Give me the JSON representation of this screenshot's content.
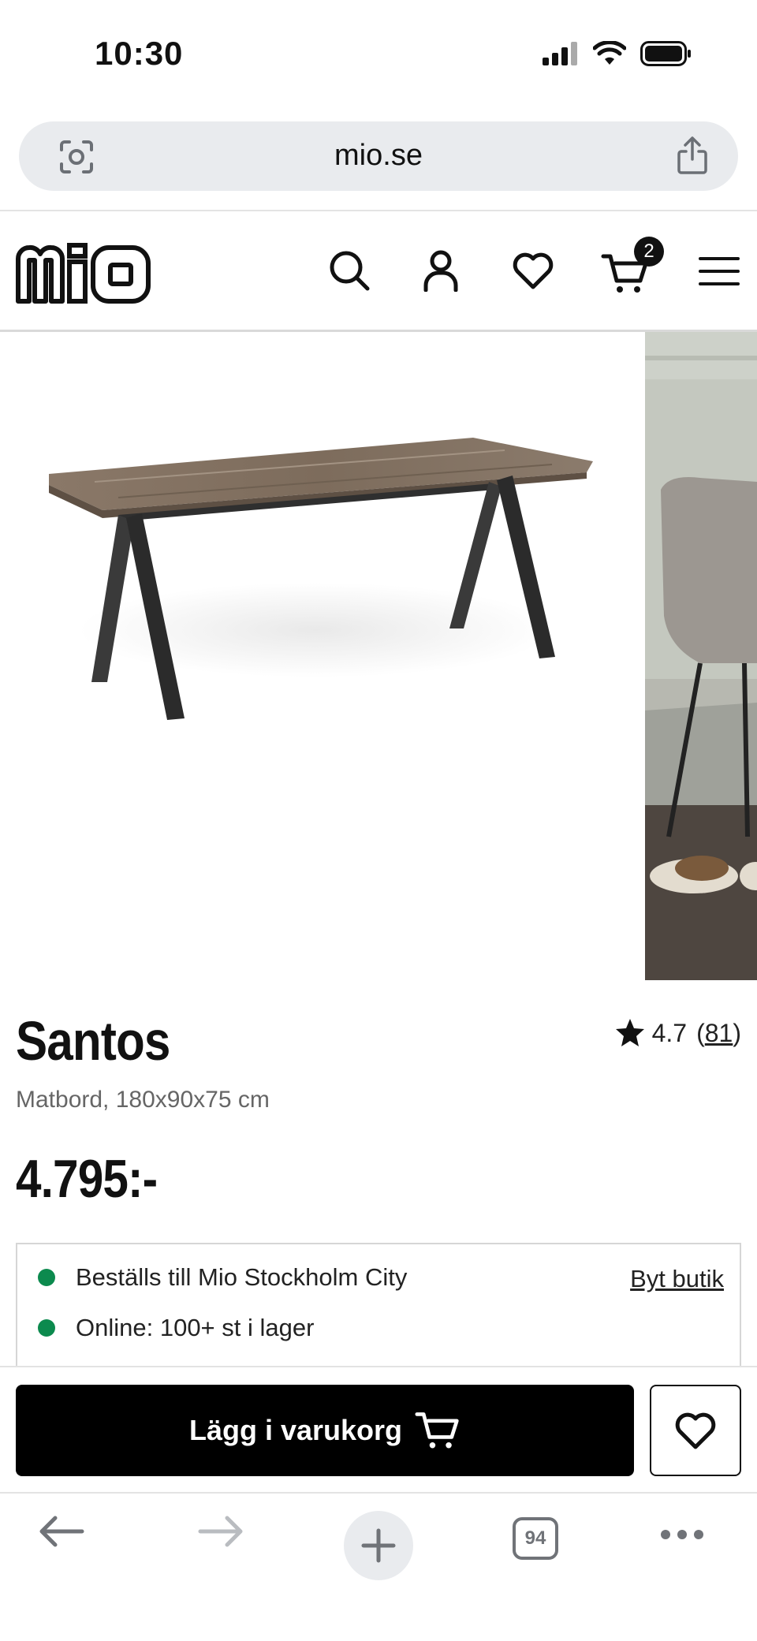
{
  "status_bar": {
    "time": "10:30"
  },
  "address_bar": {
    "url": "mio.se"
  },
  "site_header": {
    "logo_text": "mio",
    "cart_count": "2"
  },
  "product": {
    "title": "Santos",
    "subtitle": "Matbord, 180x90x75 cm",
    "price": "4.795:-",
    "rating_value": "4.7",
    "rating_count_open": "(",
    "rating_count": "81",
    "rating_count_close": ")"
  },
  "stock": {
    "store_line": "Beställs till Mio Stockholm City",
    "change_store": "Byt butik",
    "online_line": "Online: 100+ st i lager",
    "status_color": "#0c8a4e"
  },
  "cta": {
    "add_to_cart": "Lägg i varukorg"
  },
  "browser_toolbar": {
    "tab_count": "94"
  },
  "icons": {
    "status": [
      "signal-icon",
      "wifi-icon",
      "battery-icon"
    ],
    "address": [
      "visual-search-icon",
      "share-icon"
    ],
    "header": [
      "search-icon",
      "account-icon",
      "heart-icon",
      "cart-icon",
      "menu-icon"
    ],
    "toolbar": [
      "back-arrow-icon",
      "forward-arrow-icon",
      "plus-icon",
      "tabs-icon",
      "more-icon"
    ]
  }
}
